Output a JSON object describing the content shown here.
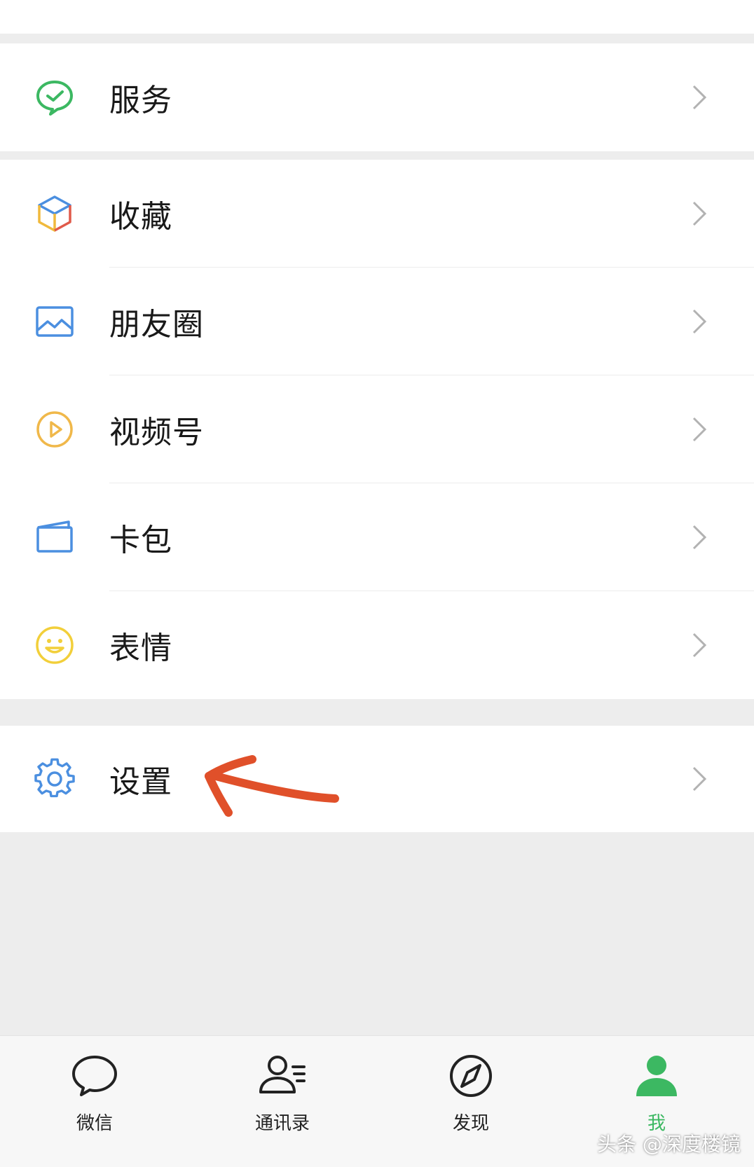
{
  "groups": [
    {
      "items": [
        {
          "label": "服务",
          "icon": "wechat-pay-icon"
        }
      ]
    },
    {
      "items": [
        {
          "label": "收藏",
          "icon": "favorites-cube-icon"
        },
        {
          "label": "朋友圈",
          "icon": "moments-image-icon"
        },
        {
          "label": "视频号",
          "icon": "channels-play-icon"
        },
        {
          "label": "卡包",
          "icon": "card-wallet-icon"
        },
        {
          "label": "表情",
          "icon": "sticker-smile-icon"
        }
      ]
    },
    {
      "items": [
        {
          "label": "设置",
          "icon": "gear-icon"
        }
      ]
    }
  ],
  "tabbar": [
    {
      "label": "微信",
      "icon": "chat-bubble-icon",
      "active": false
    },
    {
      "label": "通讯录",
      "icon": "contacts-icon",
      "active": false
    },
    {
      "label": "发现",
      "icon": "compass-icon",
      "active": false
    },
    {
      "label": "我",
      "icon": "person-icon",
      "active": true
    }
  ],
  "colors": {
    "accent": "#3cb862",
    "annotation_arrow": "#e0502a",
    "background": "#ededed"
  },
  "watermark": "头条 @深度楼镜"
}
